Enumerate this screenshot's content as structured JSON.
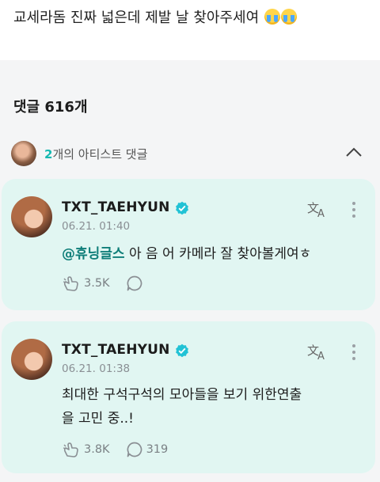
{
  "post": {
    "text": "교세라돔 진짜 넓은데 제발 날 찾아주세여",
    "emoji": [
      "loudly-crying-face",
      "loudly-crying-face"
    ]
  },
  "comments_header": {
    "label": "댓글 616개"
  },
  "artist_section": {
    "count": "2",
    "label_suffix": "개의 아티스트 댓글",
    "collapse_icon": "chevron-up-icon"
  },
  "comments": [
    {
      "author": "TXT_TAEHYUN",
      "verified": true,
      "date": "06.21. 01:40",
      "mention": "@휴닝글스",
      "text": " 아 음 어 카메라 잘 찾아볼게여ㅎ",
      "likes": "3.5K",
      "replies": ""
    },
    {
      "author": "TXT_TAEHYUN",
      "verified": true,
      "date": "06.21. 01:38",
      "mention": "",
      "text_line1": "최대한 구석구석의 모아들을 보기 위한연출",
      "text_line2": "을 고민 중..!",
      "likes": "3.8K",
      "replies": "319"
    }
  ],
  "colors": {
    "card_bg": "#e1f6f2",
    "accent": "#16b9b1",
    "verified": "#21c2d5",
    "mention": "#0f7e79"
  }
}
